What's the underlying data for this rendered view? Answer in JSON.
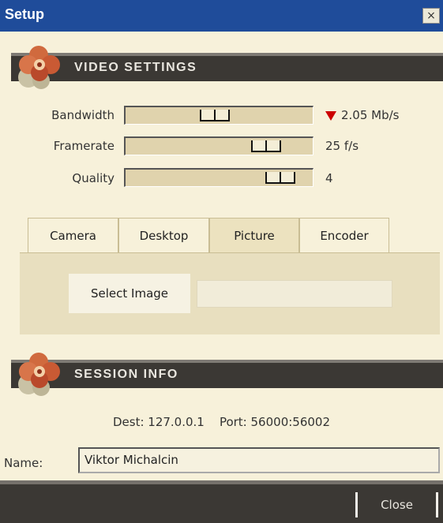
{
  "window": {
    "title": "Setup",
    "close_glyph": "×"
  },
  "video_settings": {
    "heading": "VIDEO SETTINGS",
    "sliders": [
      {
        "label": "Bandwidth",
        "value_text": "2.05 Mb/s",
        "position": 0.47,
        "indicator": "down-arrow-red"
      },
      {
        "label": "Framerate",
        "value_text": "25 f/s",
        "position": 0.8
      },
      {
        "label": "Quality",
        "value_text": "4",
        "position": 0.89
      }
    ]
  },
  "tabs": {
    "items": [
      "Camera",
      "Desktop",
      "Picture",
      "Encoder"
    ],
    "active": "Picture"
  },
  "picture_panel": {
    "select_button_label": "Select Image",
    "image_path_value": ""
  },
  "session_info": {
    "heading": "SESSION INFO",
    "dest_label": "Dest:",
    "dest_value": "127.0.0.1",
    "port_label": "Port:",
    "port_value": "56000:56002",
    "name_label": "Name:",
    "name_value": "Viktor Michalcin"
  },
  "footer": {
    "close_label": "Close"
  },
  "colors": {
    "titlebar": "#1f4c9a",
    "panel_bg": "#f7f1da",
    "section_bar": "#3b3834",
    "slider_track": "#e0d3ad",
    "accent_red": "#cc0000"
  }
}
